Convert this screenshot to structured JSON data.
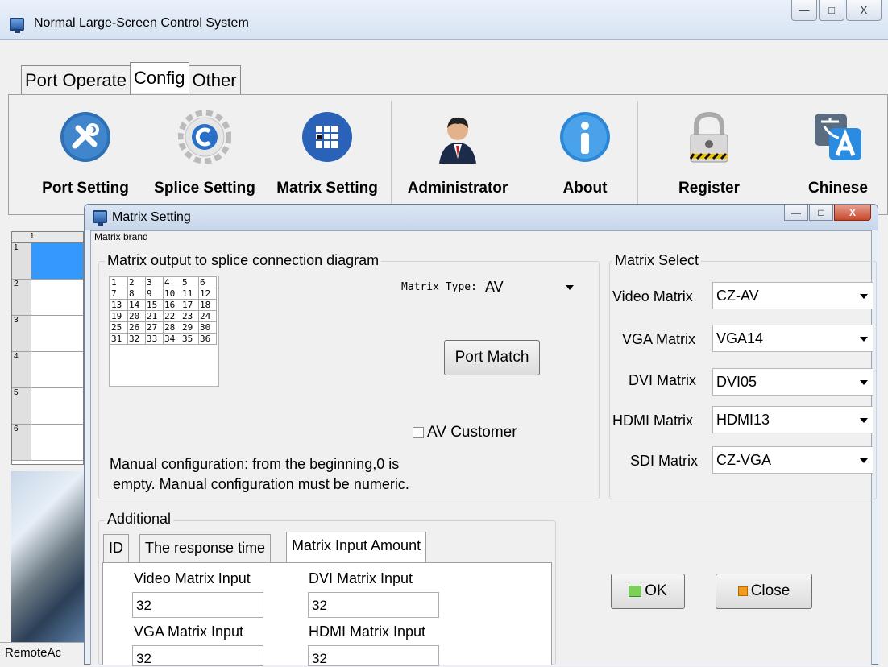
{
  "window": {
    "title": "Normal Large-Screen Control System",
    "minimize": "—",
    "maximize": "□",
    "close": "X"
  },
  "main_tabs": [
    "Port Operate",
    "Config",
    "Other"
  ],
  "ribbon": {
    "items": [
      {
        "label": "Port Setting",
        "icon": "tools-icon"
      },
      {
        "label": "Splice Setting",
        "icon": "gear-icon"
      },
      {
        "label": "Matrix Setting",
        "icon": "grid-icon"
      },
      {
        "label": "Administrator",
        "icon": "user-icon"
      },
      {
        "label": "About",
        "icon": "info-icon"
      },
      {
        "label": "Register",
        "icon": "lock-icon"
      },
      {
        "label": "Chinese",
        "icon": "translate-icon"
      }
    ]
  },
  "grid": {
    "column_header": "1",
    "rows": [
      "1",
      "2",
      "3",
      "4",
      "5",
      "6"
    ]
  },
  "statusbar": {
    "text": "RemoteAc"
  },
  "dialog": {
    "title": "Matrix Setting",
    "close": "X",
    "group_label": "Matrix brand",
    "diagram": {
      "legend": "Matrix output to splice connection diagram",
      "cells": [
        [
          "1",
          "2",
          "3",
          "4",
          "5",
          "6"
        ],
        [
          "7",
          "8",
          "9",
          "10",
          "11",
          "12"
        ],
        [
          "13",
          "14",
          "15",
          "16",
          "17",
          "18"
        ],
        [
          "19",
          "20",
          "21",
          "22",
          "23",
          "24"
        ],
        [
          "25",
          "26",
          "27",
          "28",
          "29",
          "30"
        ],
        [
          "31",
          "32",
          "33",
          "34",
          "35",
          "36"
        ]
      ],
      "matrix_type_label": "Matrix Type:",
      "matrix_type_value": "AV",
      "port_match": "Port Match",
      "av_customer": "AV Customer",
      "note_line1": "Manual configuration: from the beginning,0 is",
      "note_line2": "empty. Manual configuration must be numeric."
    },
    "matrix_select": {
      "legend": "Matrix Select",
      "rows": [
        {
          "label": "Video Matrix",
          "value": "CZ-AV"
        },
        {
          "label": "VGA Matrix",
          "value": "VGA14"
        },
        {
          "label": "DVI Matrix",
          "value": "DVI05"
        },
        {
          "label": "HDMI Matrix",
          "value": "HDMI13"
        },
        {
          "label": "SDI Matrix",
          "value": "CZ-VGA"
        }
      ]
    },
    "additional": {
      "legend": "Additional",
      "tabs": [
        "ID",
        "The response time",
        "Matrix Input Amount"
      ],
      "fields": [
        {
          "label": "Video Matrix Input",
          "value": "32"
        },
        {
          "label": "DVI Matrix Input",
          "value": "32"
        },
        {
          "label": "VGA Matrix Input",
          "value": "32"
        },
        {
          "label": "HDMI Matrix Input",
          "value": "32"
        }
      ]
    },
    "ok": "OK",
    "close_button": "Close"
  }
}
